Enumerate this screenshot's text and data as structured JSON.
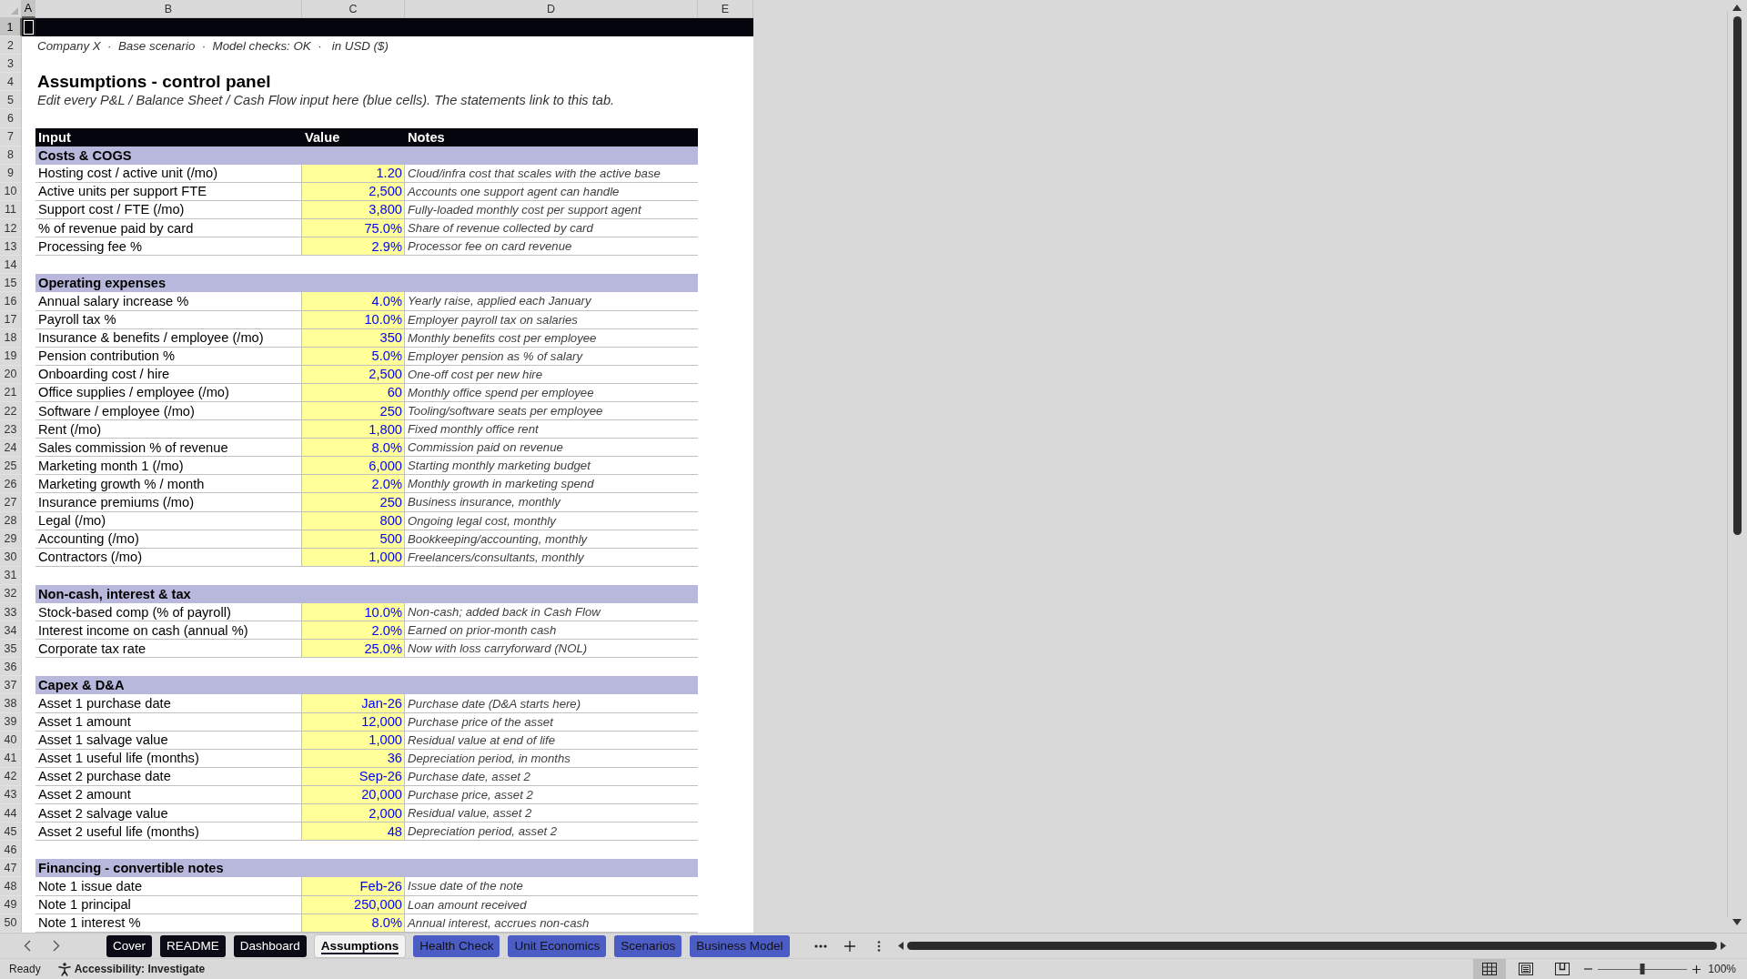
{
  "sheet": {
    "column_headers": [
      {
        "label": "A",
        "selected": true
      },
      {
        "label": "B",
        "selected": false
      },
      {
        "label": "C",
        "selected": false
      },
      {
        "label": "D",
        "selected": false
      },
      {
        "label": "E",
        "selected": false
      }
    ],
    "row_headers": [
      {
        "label": "1",
        "selected": true
      },
      {
        "label": "2",
        "selected": false
      },
      {
        "label": "3",
        "selected": false
      },
      {
        "label": "4",
        "selected": false
      },
      {
        "label": "5",
        "selected": false
      },
      {
        "label": "6",
        "selected": false
      },
      {
        "label": "7",
        "selected": false
      },
      {
        "label": "8",
        "selected": false
      },
      {
        "label": "9",
        "selected": false
      },
      {
        "label": "10",
        "selected": false
      },
      {
        "label": "11",
        "selected": false
      },
      {
        "label": "12",
        "selected": false
      },
      {
        "label": "13",
        "selected": false
      },
      {
        "label": "14",
        "selected": false
      },
      {
        "label": "15",
        "selected": false
      },
      {
        "label": "16",
        "selected": false
      },
      {
        "label": "17",
        "selected": false
      },
      {
        "label": "18",
        "selected": false
      },
      {
        "label": "19",
        "selected": false
      },
      {
        "label": "20",
        "selected": false
      },
      {
        "label": "21",
        "selected": false
      },
      {
        "label": "22",
        "selected": false
      },
      {
        "label": "23",
        "selected": false
      },
      {
        "label": "24",
        "selected": false
      },
      {
        "label": "25",
        "selected": false
      },
      {
        "label": "26",
        "selected": false
      },
      {
        "label": "27",
        "selected": false
      },
      {
        "label": "28",
        "selected": false
      },
      {
        "label": "29",
        "selected": false
      },
      {
        "label": "30",
        "selected": false
      },
      {
        "label": "31",
        "selected": false
      },
      {
        "label": "32",
        "selected": false
      },
      {
        "label": "33",
        "selected": false
      },
      {
        "label": "34",
        "selected": false
      },
      {
        "label": "35",
        "selected": false
      },
      {
        "label": "36",
        "selected": false
      },
      {
        "label": "37",
        "selected": false
      },
      {
        "label": "38",
        "selected": false
      },
      {
        "label": "39",
        "selected": false
      },
      {
        "label": "40",
        "selected": false
      },
      {
        "label": "41",
        "selected": false
      },
      {
        "label": "42",
        "selected": false
      },
      {
        "label": "43",
        "selected": false
      },
      {
        "label": "44",
        "selected": false
      },
      {
        "label": "45",
        "selected": false
      },
      {
        "label": "46",
        "selected": false
      },
      {
        "label": "47",
        "selected": false
      },
      {
        "label": "48",
        "selected": false
      },
      {
        "label": "49",
        "selected": false
      },
      {
        "label": "50",
        "selected": false
      }
    ],
    "subtitle": "Company X  ·  Base scenario  ·  Model checks: OK  ·   in USD ($)",
    "title": "Assumptions - control panel",
    "description": "Edit every P&L / Balance Sheet / Cash Flow input here (blue cells). The statements link to this tab.",
    "table": {
      "columns": [
        "Input",
        "Value",
        "Notes"
      ],
      "sections": [
        {
          "title": "Costs & COGS",
          "rows": [
            {
              "input": "Hosting cost / active unit (/mo)",
              "value": "1.20",
              "note": "Cloud/infra cost that scales with the active base"
            },
            {
              "input": "Active units per support FTE",
              "value": "2,500",
              "note": "Accounts one support agent can handle"
            },
            {
              "input": "Support cost / FTE (/mo)",
              "value": "3,800",
              "note": "Fully-loaded monthly cost per support agent"
            },
            {
              "input": "% of revenue paid by card",
              "value": "75.0%",
              "note": "Share of revenue collected by card"
            },
            {
              "input": "Processing fee %",
              "value": "2.9%",
              "note": "Processor fee on card revenue"
            }
          ]
        },
        {
          "title": "Operating expenses",
          "rows": [
            {
              "input": "Annual salary increase %",
              "value": "4.0%",
              "note": "Yearly raise, applied each January"
            },
            {
              "input": "Payroll tax %",
              "value": "10.0%",
              "note": "Employer payroll tax on salaries"
            },
            {
              "input": "Insurance & benefits / employee (/mo)",
              "value": "350",
              "note": "Monthly benefits cost per employee"
            },
            {
              "input": "Pension contribution %",
              "value": "5.0%",
              "note": "Employer pension as % of salary"
            },
            {
              "input": "Onboarding cost / hire",
              "value": "2,500",
              "note": "One-off cost per new hire"
            },
            {
              "input": "Office supplies / employee (/mo)",
              "value": "60",
              "note": "Monthly office spend per employee"
            },
            {
              "input": "Software / employee (/mo)",
              "value": "250",
              "note": "Tooling/software seats per employee"
            },
            {
              "input": "Rent (/mo)",
              "value": "1,800",
              "note": "Fixed monthly office rent"
            },
            {
              "input": "Sales commission % of revenue",
              "value": "8.0%",
              "note": "Commission paid on revenue"
            },
            {
              "input": "Marketing month 1 (/mo)",
              "value": "6,000",
              "note": "Starting monthly marketing budget"
            },
            {
              "input": "Marketing growth % / month",
              "value": "2.0%",
              "note": "Monthly growth in marketing spend"
            },
            {
              "input": "Insurance premiums (/mo)",
              "value": "250",
              "note": "Business insurance, monthly"
            },
            {
              "input": "Legal (/mo)",
              "value": "800",
              "note": "Ongoing legal cost, monthly"
            },
            {
              "input": "Accounting (/mo)",
              "value": "500",
              "note": "Bookkeeping/accounting, monthly"
            },
            {
              "input": "Contractors (/mo)",
              "value": "1,000",
              "note": "Freelancers/consultants, monthly"
            }
          ]
        },
        {
          "title": "Non-cash, interest & tax",
          "rows": [
            {
              "input": "Stock-based comp (% of payroll)",
              "value": "10.0%",
              "note": "Non-cash; added back in Cash Flow"
            },
            {
              "input": "Interest income on cash (annual %)",
              "value": "2.0%",
              "note": "Earned on prior-month cash"
            },
            {
              "input": "Corporate tax rate",
              "value": "25.0%",
              "note": "Now with loss carryforward (NOL)"
            }
          ]
        },
        {
          "title": "Capex & D&A",
          "rows": [
            {
              "input": "Asset 1 purchase date",
              "value": "Jan-26",
              "note": "Purchase date (D&A starts here)"
            },
            {
              "input": "Asset 1 amount",
              "value": "12,000",
              "note": "Purchase price of the asset"
            },
            {
              "input": "Asset 1 salvage value",
              "value": "1,000",
              "note": "Residual value at end of life"
            },
            {
              "input": "Asset 1 useful life (months)",
              "value": "36",
              "note": "Depreciation period, in months"
            },
            {
              "input": "Asset 2 purchase date",
              "value": "Sep-26",
              "note": "Purchase date, asset 2"
            },
            {
              "input": "Asset 2 amount",
              "value": "20,000",
              "note": "Purchase price, asset 2"
            },
            {
              "input": "Asset 2 salvage value",
              "value": "2,000",
              "note": "Residual value, asset 2"
            },
            {
              "input": "Asset 2 useful life (months)",
              "value": "48",
              "note": "Depreciation period, asset 2"
            }
          ]
        },
        {
          "title": "Financing - convertible notes",
          "rows": [
            {
              "input": "Note 1 issue date",
              "value": "Feb-26",
              "note": "Issue date of the note"
            },
            {
              "input": "Note 1 principal",
              "value": "250,000",
              "note": "Loan amount received"
            },
            {
              "input": "Note 1 interest %",
              "value": "8.0%",
              "note": "Annual interest, accrues non-cash"
            }
          ]
        }
      ]
    }
  },
  "sheet_tabs": [
    {
      "label": "Cover",
      "selected": false,
      "color": "#0b0b16"
    },
    {
      "label": "README",
      "selected": false,
      "color": "#0b0b16"
    },
    {
      "label": "Dashboard",
      "selected": false,
      "color": "#0b0b16"
    },
    {
      "label": "Assumptions",
      "selected": true,
      "color": "#1b1b2f"
    },
    {
      "label": "Health Check",
      "selected": false,
      "color": "#4b5cc4"
    },
    {
      "label": "Unit Economics",
      "selected": false,
      "color": "#4b5cc4"
    },
    {
      "label": "Scenarios",
      "selected": false,
      "color": "#4b5cc4"
    },
    {
      "label": "Business Model",
      "selected": false,
      "color": "#4b5cc4"
    }
  ],
  "status_bar": {
    "status": "Ready",
    "accessibility": "Accessibility: Investigate",
    "views": [
      {
        "kind": "normal",
        "selected": true
      },
      {
        "kind": "page_layout",
        "selected": false
      },
      {
        "kind": "page_break",
        "selected": false
      }
    ],
    "zoom": {
      "level": 0.5,
      "reading": "100%"
    }
  }
}
